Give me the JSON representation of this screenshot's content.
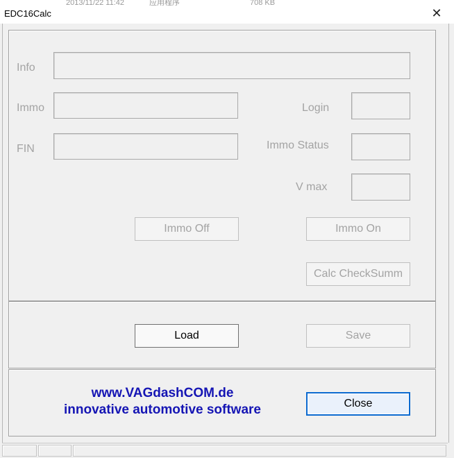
{
  "window": {
    "title": "EDC16Calc",
    "close_glyph": "✕",
    "behind": {
      "date": "2013/11/22 11:42",
      "type": "应用程序",
      "size": "708 KB"
    }
  },
  "labels": {
    "info": "Info",
    "immo": "Immo",
    "fin": "FIN",
    "login": "Login",
    "immo_status": "Immo Status",
    "v_max": "V max"
  },
  "fields": {
    "info": "",
    "immo": "",
    "fin": "",
    "login": "",
    "immo_status": "",
    "v_max": ""
  },
  "buttons": {
    "immo_off": "Immo Off",
    "immo_on": "Immo On",
    "calc_checksumm": "Calc CheckSumm",
    "load": "Load",
    "save": "Save",
    "close": "Close"
  },
  "brand": {
    "url": "www.VAGdashCOM.de",
    "tagline": "innovative automotive software",
    "color": "#1515b4"
  }
}
